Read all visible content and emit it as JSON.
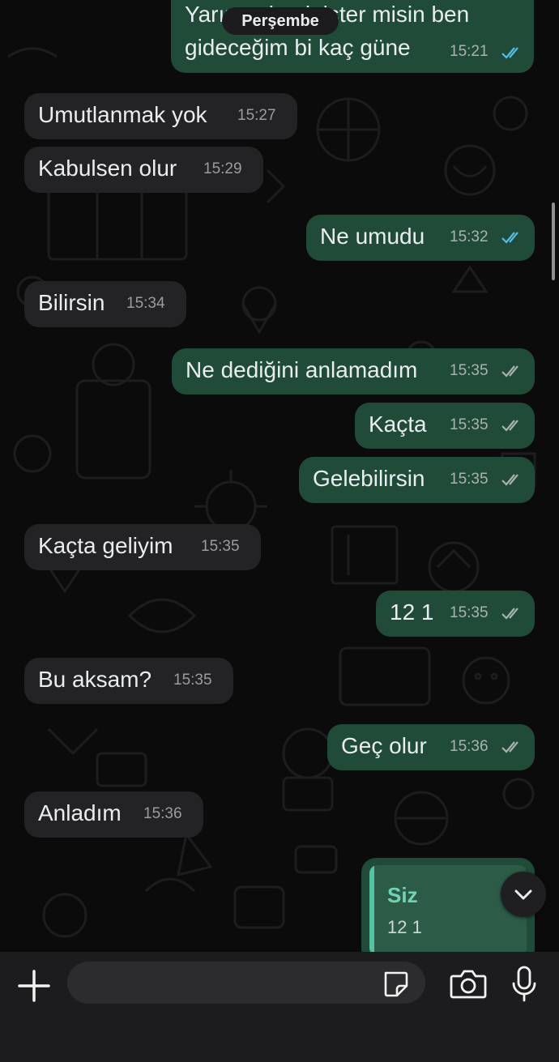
{
  "date_separator": "Perşembe",
  "first_message": {
    "line1": "Yarın gelmek ister misin ben",
    "line2": "gideceğim bi kaç güne",
    "time": "15:21",
    "status": "read"
  },
  "messages": [
    {
      "dir": "in",
      "text": "Umutlanmak yok",
      "time": "15:27"
    },
    {
      "dir": "in",
      "text": "Kabulsen olur",
      "time": "15:29"
    },
    {
      "dir": "out",
      "text": "Ne umudu",
      "time": "15:32",
      "status": "read"
    },
    {
      "dir": "in",
      "text": "Bilirsin",
      "time": "15:34"
    },
    {
      "dir": "out",
      "text": "Ne dediğini anlamadım",
      "time": "15:35",
      "status": "delivered"
    },
    {
      "dir": "out",
      "text": "Kaçta",
      "time": "15:35",
      "status": "delivered"
    },
    {
      "dir": "out",
      "text": "Gelebilirsin",
      "time": "15:35",
      "status": "delivered"
    },
    {
      "dir": "in",
      "text": "Kaçta geliyim",
      "time": "15:35"
    },
    {
      "dir": "out",
      "text": "12 1",
      "time": "15:35",
      "status": "delivered"
    },
    {
      "dir": "in",
      "text": "Bu aksam?",
      "time": "15:35"
    },
    {
      "dir": "out",
      "text": "Geç olur",
      "time": "15:36",
      "status": "delivered"
    },
    {
      "dir": "in",
      "text": "Anladım",
      "time": "15:36"
    }
  ],
  "reply_preview": {
    "author": "Siz",
    "quoted_text": "12 1"
  },
  "composer": {
    "placeholder": "",
    "icons": [
      "plus-icon",
      "sticker-icon",
      "camera-icon",
      "microphone-icon"
    ]
  },
  "colors": {
    "background": "#0b0b0b",
    "incoming_bubble": "#232326",
    "outgoing_bubble": "#1f4b38",
    "read_ticks": "#53bdeb",
    "delivered_ticks": "#a9b3ad",
    "reply_accent": "#55c3a3"
  }
}
